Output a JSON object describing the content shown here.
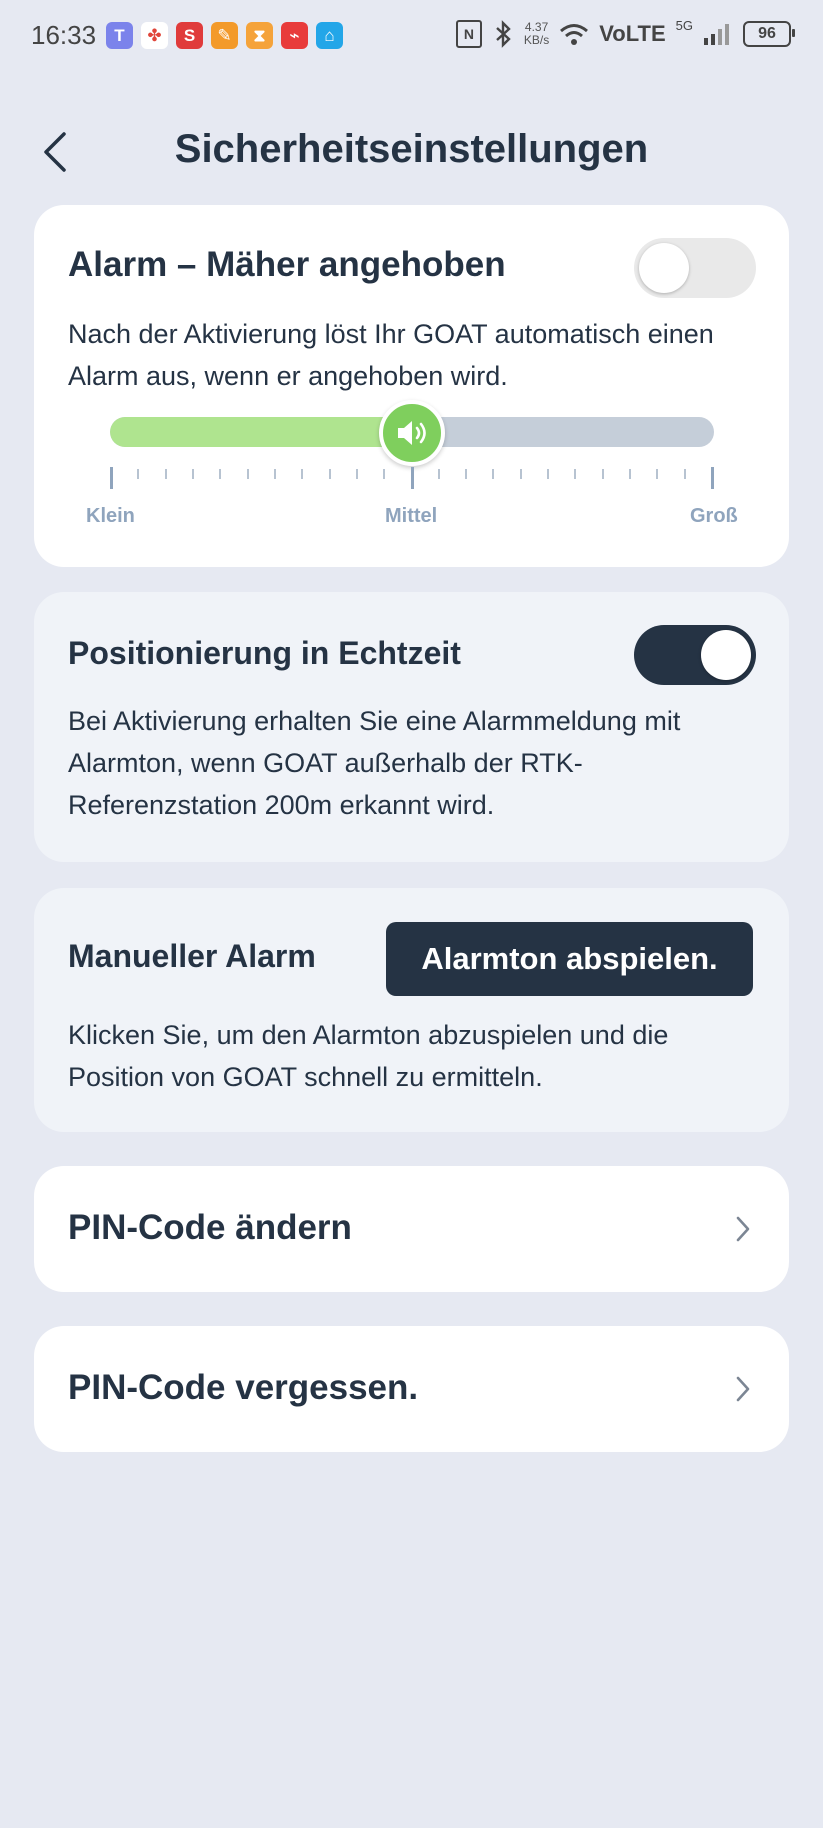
{
  "status_bar": {
    "time": "16:33",
    "speed_value": "4.37",
    "speed_unit": "KB/s",
    "network": "VoLTE",
    "network_gen": "5G",
    "battery": "96",
    "app_icons": [
      {
        "name": "teams-icon",
        "color": "#7b83eb",
        "glyph": "T"
      },
      {
        "name": "slack-icon",
        "color": "#ffffff",
        "glyph": "✤"
      },
      {
        "name": "s-app-icon",
        "color": "#e03b3b",
        "glyph": "S"
      },
      {
        "name": "notes-app-icon",
        "color": "#f39a2a",
        "glyph": "✎"
      },
      {
        "name": "hourglass-app-icon",
        "color": "#f5a33a",
        "glyph": "⧗"
      },
      {
        "name": "red-app-icon",
        "color": "#e83b3b",
        "glyph": "⌁"
      },
      {
        "name": "home-app-icon",
        "color": "#23a6e8",
        "glyph": "⌂"
      }
    ]
  },
  "header": {
    "title": "Sicherheitseinstellungen"
  },
  "lift_alarm": {
    "title": "Alarm – Mäher angehoben",
    "description": "Nach der Aktivierung löst Ihr GOAT automatisch einen Alarm aus, wenn er angehoben wird.",
    "enabled": false,
    "volume_level": 0.5,
    "labels": {
      "min": "Klein",
      "mid": "Mittel",
      "max": "Groß"
    }
  },
  "realtime_positioning": {
    "title": "Positionierung in Echtzeit",
    "description": "Bei Aktivierung erhalten Sie eine Alarmmeldung mit Alarmton, wenn GOAT außerhalb der RTK-Referenzstation 200m erkannt wird.",
    "enabled": true
  },
  "manual_alarm": {
    "title": "Manueller Alarm",
    "button_label": "Alarmton abspielen.",
    "description": "Klicken Sie, um den Alarmton abzuspielen und die Position von GOAT schnell zu ermitteln."
  },
  "pin_change": {
    "label": "PIN-Code ändern"
  },
  "pin_forgot": {
    "label": "PIN-Code vergessen."
  },
  "colors": {
    "background": "#e6e9f2",
    "accent_dark": "#253344",
    "slider_fill": "#afe48f",
    "slider_thumb": "#7fcf5d"
  }
}
